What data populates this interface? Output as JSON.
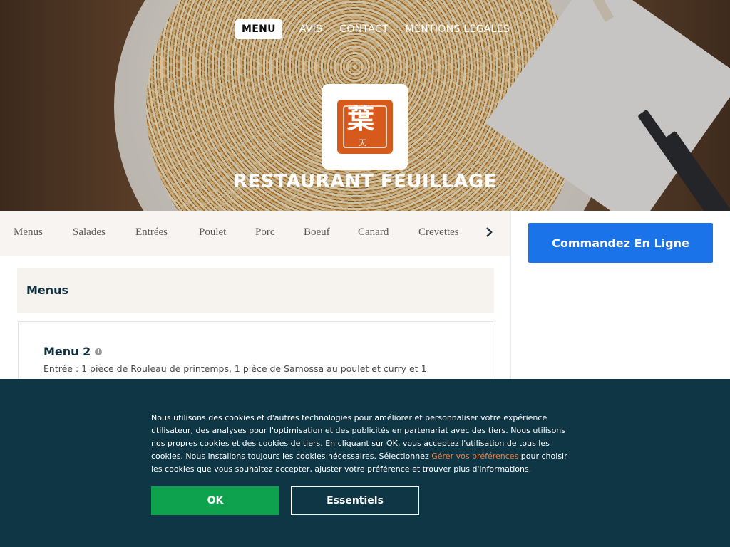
{
  "colors": {
    "accent_blue": "#1a73e8",
    "cookie_bg": "#0e3645",
    "ok_green": "#0fa24e",
    "link_orange": "#f07f3c",
    "title_navy": "#0e2f3d",
    "category_bg": "#f7f4f1"
  },
  "nav": {
    "items": [
      {
        "label": "MENU",
        "active": true
      },
      {
        "label": "AVIS"
      },
      {
        "label": "CONTACT"
      },
      {
        "label": "MENTIONS LÉGALES"
      }
    ]
  },
  "hero": {
    "restaurant_name": "RESTAURANT FEUILLAGE",
    "logo_icon": "seal-logo-icon"
  },
  "categories": {
    "items": [
      "Menus",
      "Salades",
      "Entrées",
      "Poulet",
      "Porc",
      "Boeuf",
      "Canard",
      "Crevettes"
    ],
    "next_icon": "chevron-right-icon"
  },
  "sidebar": {
    "order_button": "Commandez En Ligne"
  },
  "section": {
    "title": "Menus",
    "item": {
      "name": "Menu 2",
      "info_icon": "info-icon",
      "description": "Entrée : 1 pièce de Rouleau de printemps, 1 pièce de Samossa au poulet et curry et 1"
    }
  },
  "cookie": {
    "text_before": "Nous utilisons des cookies et d'autres technologies pour améliorer et personnaliser votre expérience utilisateur, des analyses pour l'optimisation et des publicités en partenariat avec des tiers. Nous utilisons nos propres cookies et des cookies de tiers. En cliquant sur OK, vous acceptez l'utilisation de tous les cookies. Nous installons toujours les cookies nécessaires. Sélectionnez ",
    "link": "Gérer vos préférences",
    "text_after": " pour choisir les cookies que vous souhaitez accepter, ajuster votre préférence et trouver plus d'informations.",
    "ok_label": "OK",
    "essentials_label": "Essentiels"
  }
}
